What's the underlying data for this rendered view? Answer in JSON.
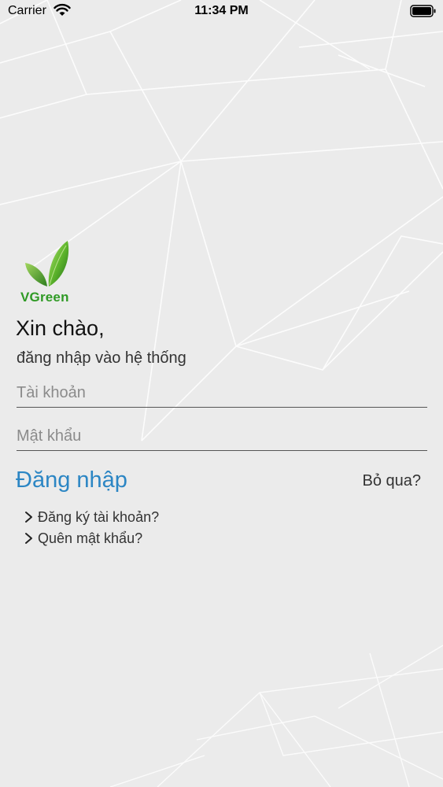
{
  "status_bar": {
    "carrier": "Carrier",
    "time": "11:34 PM"
  },
  "logo": {
    "text": "VGreen"
  },
  "greeting": "Xin chào,",
  "subtitle": "đăng nhập vào hệ thống",
  "form": {
    "username_placeholder": "Tài khoản",
    "password_placeholder": "Mật khẩu"
  },
  "actions": {
    "login_label": "Đăng nhập",
    "skip_label": "Bỏ qua?",
    "register_label": "Đăng ký tài khoản?",
    "forgot_label": "Quên mật khẩu?"
  },
  "colors": {
    "background": "#ebebeb",
    "accent_blue": "#2c86c4",
    "brand_green": "#2f9a25"
  }
}
